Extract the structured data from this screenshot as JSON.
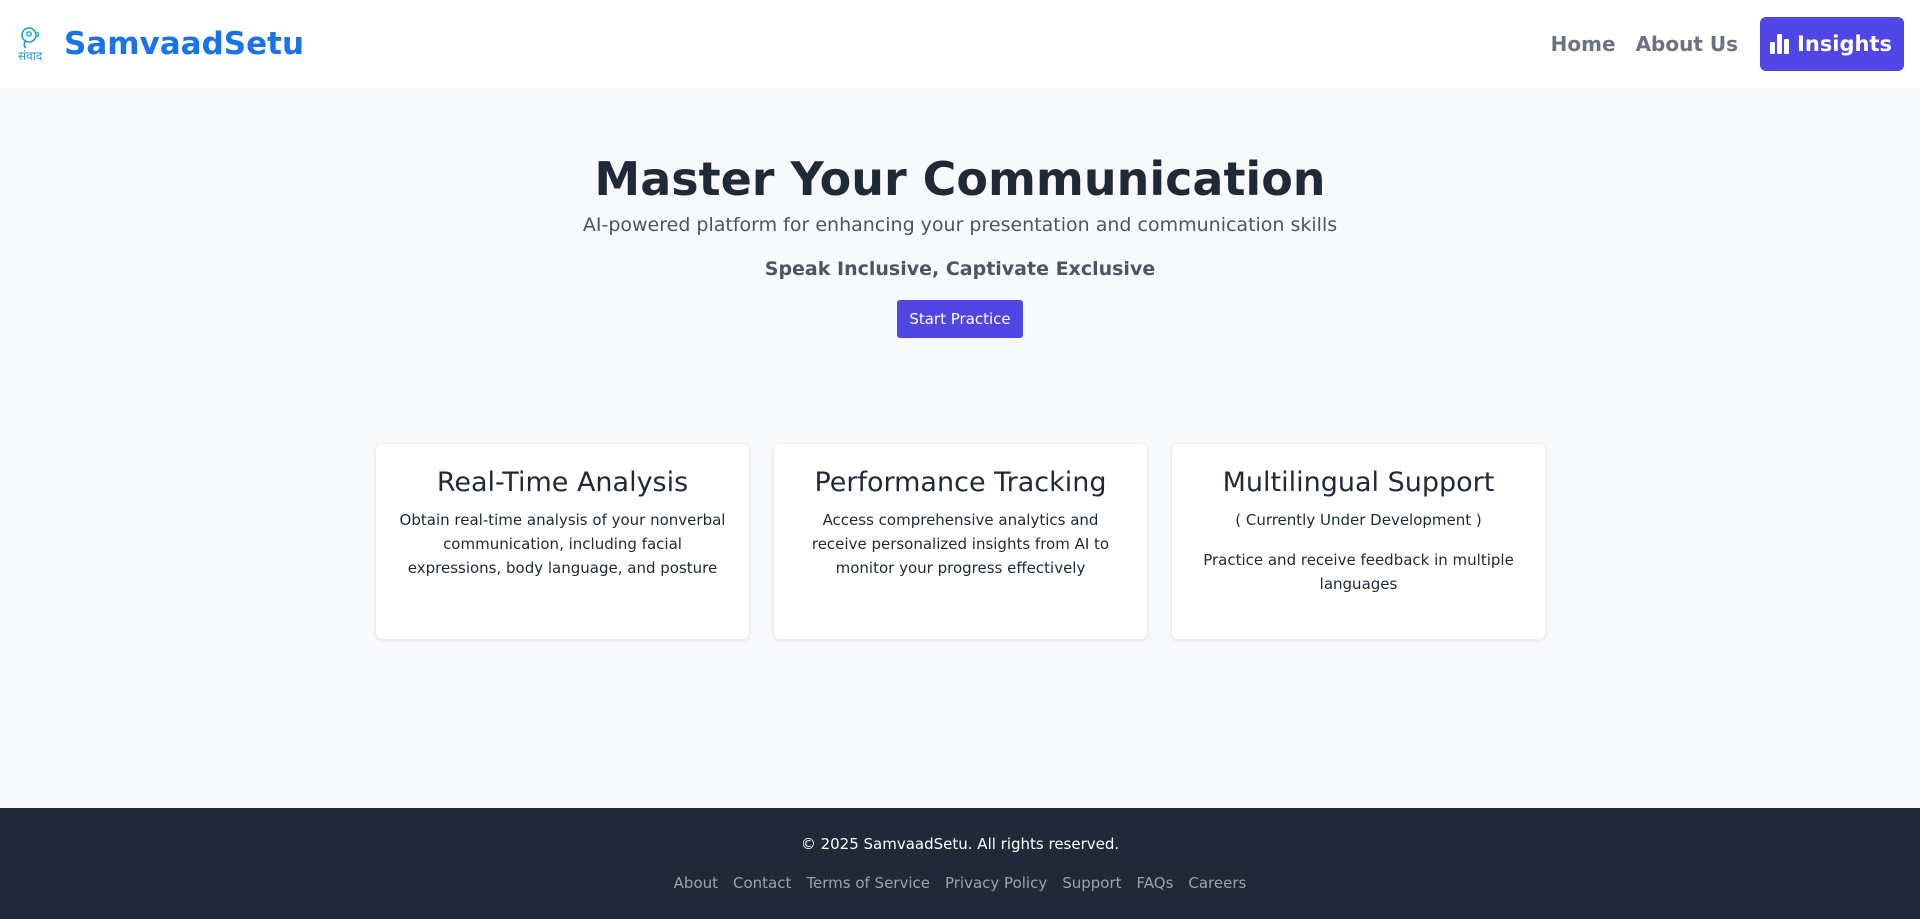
{
  "header": {
    "brand_name": "SamvaadSetu",
    "logo_text": "संवाद",
    "nav": {
      "home": "Home",
      "about": "About Us",
      "insights": "Insights"
    }
  },
  "hero": {
    "title": "Master Your Communication",
    "subtitle": "AI-powered platform for enhancing your presentation and communication skills",
    "tagline": "Speak Inclusive, Captivate Exclusive",
    "cta": "Start Practice"
  },
  "features": [
    {
      "title": "Real-Time Analysis",
      "text": "Obtain real-time analysis of your nonverbal communication, including facial expressions, body language, and posture"
    },
    {
      "title": "Performance Tracking",
      "text": "Access comprehensive analytics and receive personalized insights from AI to monitor your progress effectively"
    },
    {
      "title": "Multilingual Support",
      "note": "( Currently Under Development )",
      "text": "Practice and receive feedback in multiple languages"
    }
  ],
  "footer": {
    "copyright": "© 2025 SamvaadSetu. All rights reserved.",
    "links": [
      "About",
      "Contact",
      "Terms of Service",
      "Privacy Policy",
      "Support",
      "FAQs",
      "Careers"
    ]
  },
  "colors": {
    "brand": "#1a73e8",
    "accent": "#4f46e5",
    "footer_bg": "#1f2937",
    "page_bg": "#f8f9fb"
  },
  "icons": {
    "logo": "speech-head-logo-icon",
    "insights": "bar-chart-icon"
  }
}
